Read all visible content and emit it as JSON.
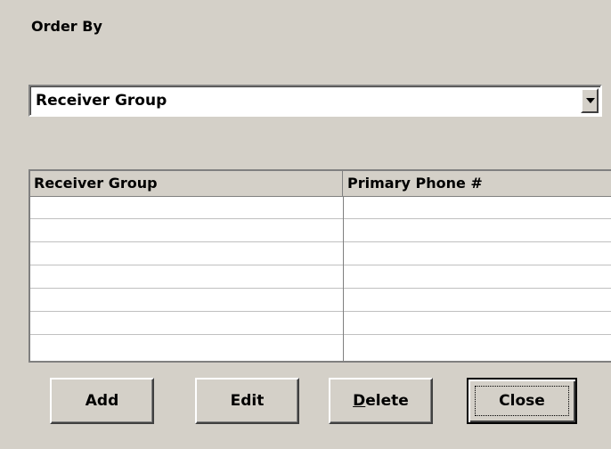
{
  "order_by": {
    "label": "Order By",
    "selected": "Receiver Group"
  },
  "grid": {
    "columns": [
      "Receiver Group",
      "Primary Phone #"
    ],
    "rows": [
      [
        "",
        ""
      ],
      [
        "",
        ""
      ],
      [
        "",
        ""
      ],
      [
        "",
        ""
      ],
      [
        "",
        ""
      ],
      [
        "",
        ""
      ],
      [
        "",
        ""
      ]
    ]
  },
  "buttons": {
    "add": "Add",
    "edit": "Edit",
    "delete_mnemonic": "D",
    "delete_rest": "elete",
    "close": "Close"
  }
}
